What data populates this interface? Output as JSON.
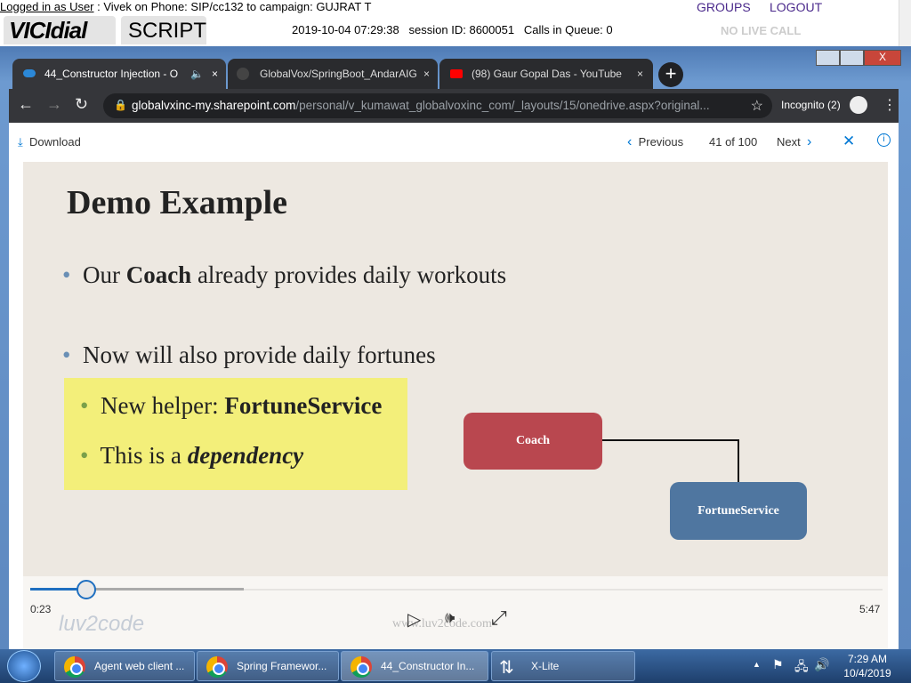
{
  "vicidial": {
    "logged_in_label": "Logged in as User",
    "login_info": " : Vivek on Phone: SIP/cc132  to campaign: GUJRAT  T",
    "groups": "GROUPS",
    "logout": "LOGOUT",
    "logo_text": "VICIdial",
    "script_tab": "SCRIPT",
    "status_line": "2019-10-04 07:29:38   session ID: 8600051   Calls in Queue: 0",
    "live_call": "NO LIVE CALL"
  },
  "browser": {
    "tabs": [
      {
        "label": "44_Constructor Injection - O",
        "active": true
      },
      {
        "label": "GlobalVox/SpringBoot_AndarAIG"
      },
      {
        "label": "(98) Gaur Gopal Das - YouTube"
      }
    ],
    "url_host": "globalvxinc-my.sharepoint.com",
    "url_path": "/personal/v_kumawat_globalvoxinc_com/_layouts/15/onedrive.aspx?original...",
    "incognito": "Incognito (2)"
  },
  "viewer": {
    "download": "Download",
    "previous": "Previous",
    "position": "41 of 100",
    "next": "Next"
  },
  "slide": {
    "title": "Demo Example",
    "bullet1_pre": "Our ",
    "bullet1_bold": "Coach",
    "bullet1_post": " already provides daily workouts",
    "bullet2": "Now will also provide daily fortunes",
    "sub1_pre": "New helper: ",
    "sub1_bold": "FortuneService",
    "sub2_pre": "This is a ",
    "sub2_em": "dependency",
    "box_coach": "Coach",
    "box_fortune": "FortuneService",
    "watermark_logo": "luv2code",
    "watermark_url": "www.luv2code.com",
    "colors": {
      "coach": "#b9474f",
      "fortune": "#4f76a0",
      "highlight": "#f3ef7a"
    }
  },
  "player": {
    "current": "0:23",
    "duration": "5:47",
    "progress": 0.066,
    "buffered": 0.25
  },
  "taskbar": {
    "items": [
      "Agent web client ...",
      "Spring Framewor...",
      "44_Constructor In...",
      "X-Lite"
    ],
    "time": "7:29 AM",
    "date": "10/4/2019"
  }
}
